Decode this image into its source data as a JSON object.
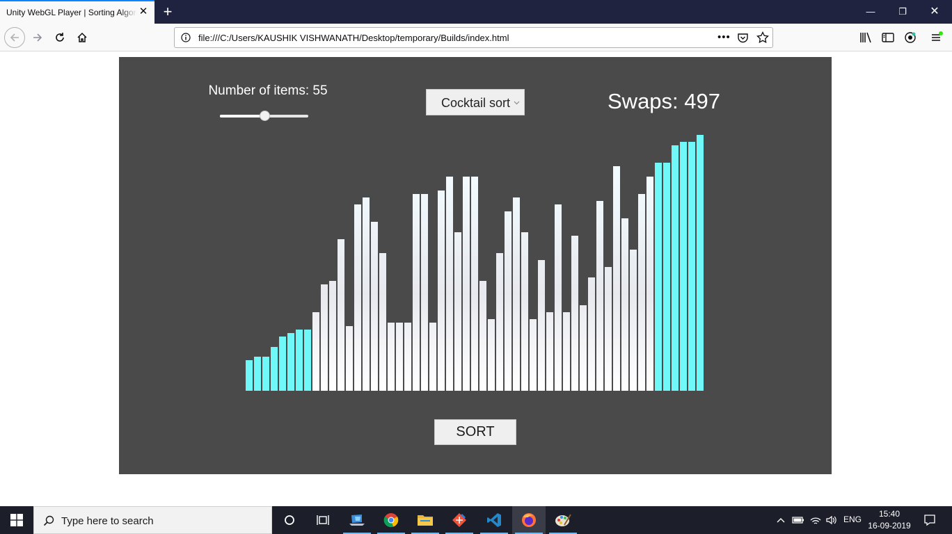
{
  "browser": {
    "tab_title": "Unity WebGL Player | Sorting Algorithms",
    "tab_close": "✕",
    "new_tab": "+",
    "url": "file:///C:/Users/KAUSHIK VISHWANATH/Desktop/temporary/Builds/index.html",
    "url_more": "•••",
    "window_min": "—",
    "window_max": "❐",
    "window_close": "✕",
    "accent_color": "#0a84ff"
  },
  "app": {
    "items_label": "Number of items: 55",
    "slider_value": 55,
    "slider_fraction": 0.5,
    "algorithm": "Cocktail sort",
    "swaps": "Swaps: 497",
    "sort_button": "SORT",
    "bar_values": [
      44,
      49,
      49,
      63,
      78,
      83,
      88,
      88,
      113,
      153,
      158,
      218,
      93,
      268,
      278,
      243,
      198,
      98,
      98,
      98,
      283,
      283,
      98,
      288,
      308,
      228,
      308,
      308,
      158,
      103,
      198,
      258,
      278,
      228,
      103,
      188,
      113,
      268,
      113,
      223,
      123,
      163,
      273,
      178,
      323,
      248,
      203,
      283,
      308,
      328,
      328,
      353,
      358,
      358,
      368
    ],
    "sorted_prefix_count": 8,
    "sorted_suffix_count": 6,
    "sorted_color": "#6ff8f7",
    "unsorted_color": "#ffffff",
    "background_color": "#4a4a4a"
  },
  "taskbar": {
    "search_placeholder": "Type here to search",
    "apps": [
      "cortana-icon",
      "task-view-icon",
      "laptop-app-icon",
      "chrome-icon",
      "file-explorer-icon",
      "git-icon",
      "vscode-icon",
      "firefox-icon",
      "paint-icon"
    ],
    "language": "ENG",
    "time": "15:40",
    "date": "16-09-2019"
  }
}
